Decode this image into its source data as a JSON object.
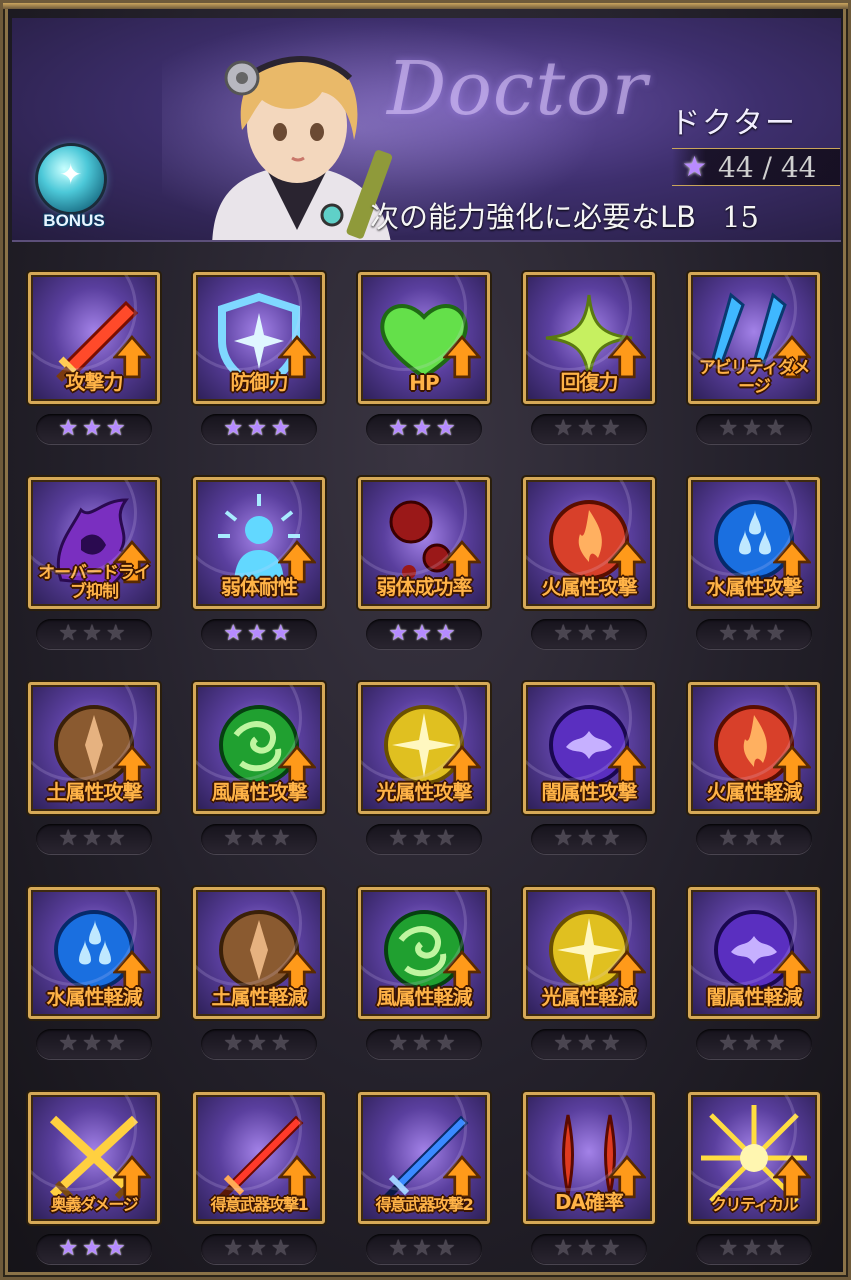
{
  "header": {
    "class_name": "Doctor",
    "class_name_jp": "ドクター",
    "bonus_label": "BONUS",
    "star_count": "44 / 44",
    "next_lb_label": "次の能力強化に必要なLB",
    "next_lb_value": "15"
  },
  "colors": {
    "frame_gold": "#d6a957",
    "label_orange": "#ffb347",
    "star_active": "#b58bff",
    "star_inactive": "#4a4550",
    "header_purple": "#3e2f6e"
  },
  "skills": [
    {
      "label": "攻撃力",
      "icon": "sword-icon",
      "stars": 3
    },
    {
      "label": "防御力",
      "icon": "shield-icon",
      "stars": 3
    },
    {
      "label": "HP",
      "icon": "heart-icon",
      "stars": 3
    },
    {
      "label": "回復力",
      "icon": "sparkle-icon",
      "stars": 0
    },
    {
      "label": "アビリティダメージ",
      "icon": "twin-daggers-icon",
      "stars": 0
    },
    {
      "label": "オーバードライブ抑制",
      "icon": "purple-flame-icon",
      "stars": 0
    },
    {
      "label": "弱体耐性",
      "icon": "person-aura-icon",
      "stars": 3
    },
    {
      "label": "弱体成功率",
      "icon": "red-orbs-icon",
      "stars": 3
    },
    {
      "label": "火属性攻撃",
      "icon": "fire-orb-icon",
      "stars": 0
    },
    {
      "label": "水属性攻撃",
      "icon": "water-orb-icon",
      "stars": 0
    },
    {
      "label": "土属性攻撃",
      "icon": "earth-orb-icon",
      "stars": 0
    },
    {
      "label": "風属性攻撃",
      "icon": "wind-orb-icon",
      "stars": 0
    },
    {
      "label": "光属性攻撃",
      "icon": "light-orb-icon",
      "stars": 0
    },
    {
      "label": "闇属性攻撃",
      "icon": "dark-orb-icon",
      "stars": 0
    },
    {
      "label": "火属性軽減",
      "icon": "fire-orb-icon",
      "stars": 0
    },
    {
      "label": "水属性軽減",
      "icon": "water-orb-icon",
      "stars": 0
    },
    {
      "label": "土属性軽減",
      "icon": "earth-orb-icon",
      "stars": 0
    },
    {
      "label": "風属性軽減",
      "icon": "wind-orb-icon",
      "stars": 0
    },
    {
      "label": "光属性軽減",
      "icon": "light-orb-icon",
      "stars": 0
    },
    {
      "label": "闇属性軽減",
      "icon": "dark-orb-icon",
      "stars": 0
    },
    {
      "label": "奥義ダメージ",
      "icon": "crossed-swords-icon",
      "stars": 3
    },
    {
      "label": "得意武器攻撃1",
      "icon": "red-sword-icon",
      "stars": 0
    },
    {
      "label": "得意武器攻撃2",
      "icon": "blue-sword-icon",
      "stars": 0
    },
    {
      "label": "DA確率",
      "icon": "double-blade-icon",
      "stars": 0
    },
    {
      "label": "クリティカル",
      "icon": "lightning-burst-icon",
      "stars": 0
    }
  ]
}
